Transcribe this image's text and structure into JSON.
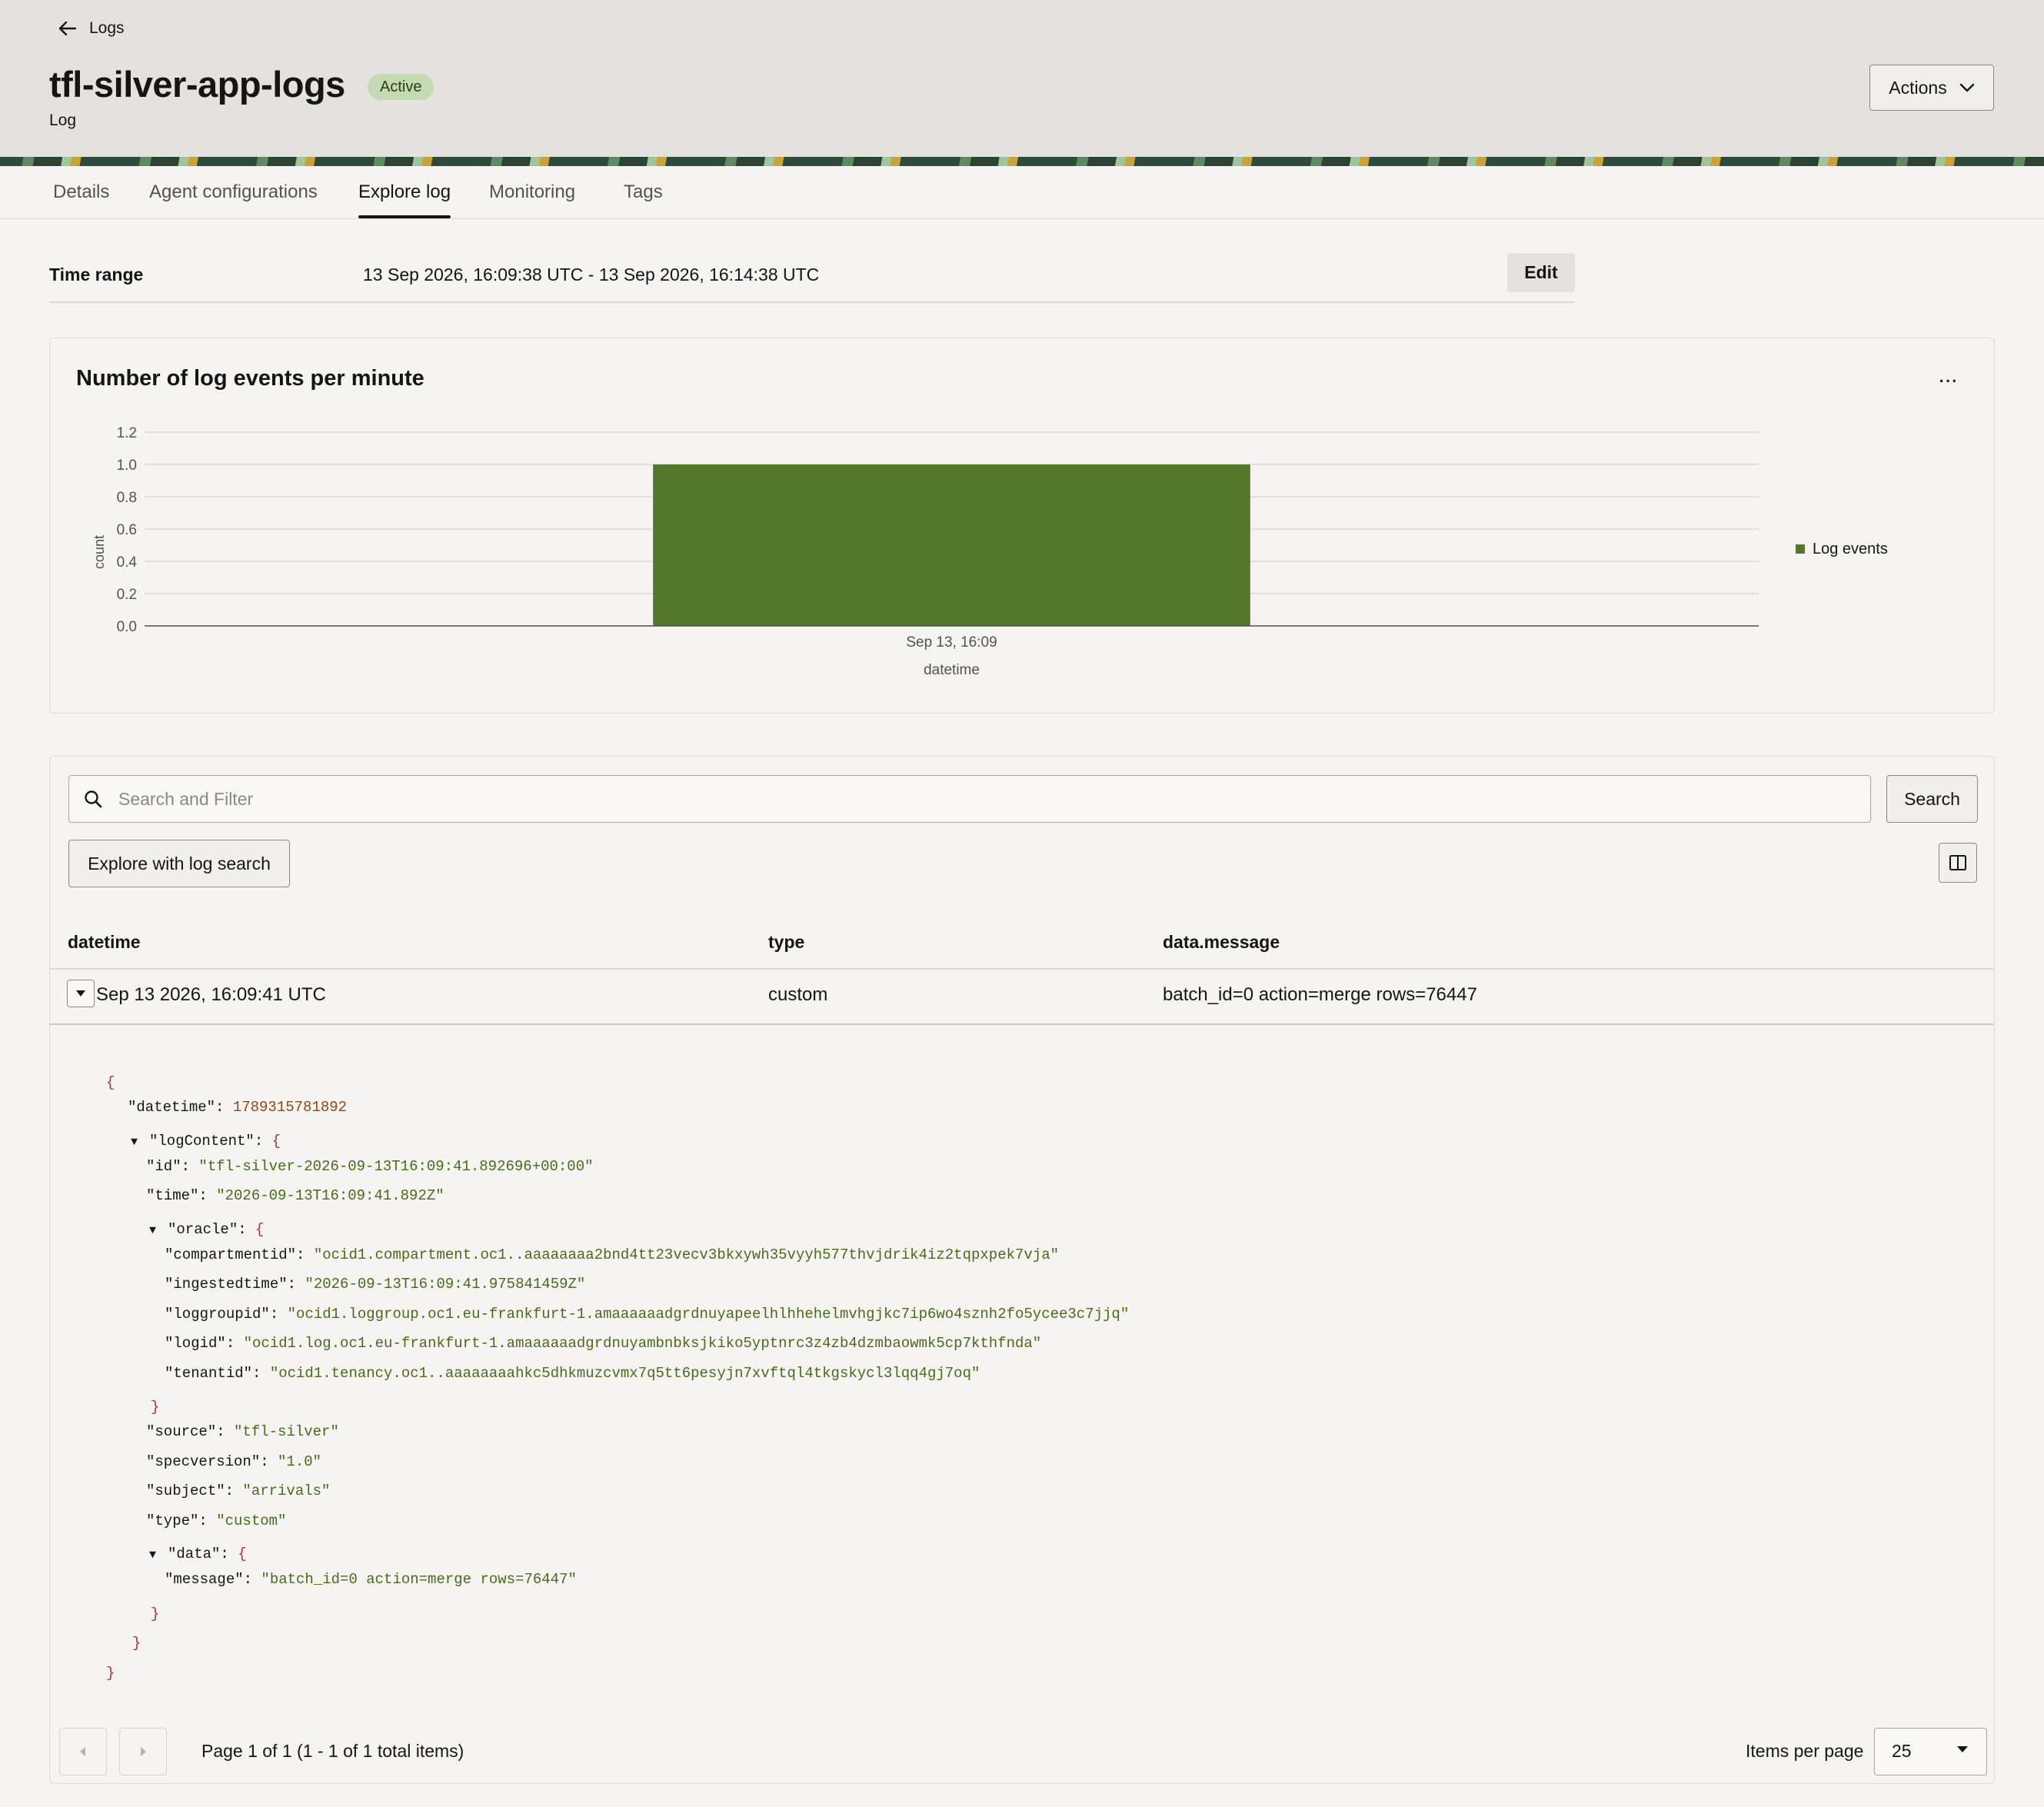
{
  "header": {
    "back_label": "Logs",
    "title": "tfl-silver-app-logs",
    "status": "Active",
    "subtitle": "Log",
    "actions_label": "Actions"
  },
  "tabs": [
    {
      "label": "Details",
      "active": false
    },
    {
      "label": "Agent configurations",
      "active": false
    },
    {
      "label": "Explore log",
      "active": true
    },
    {
      "label": "Monitoring",
      "active": false
    },
    {
      "label": "Tags",
      "active": false
    }
  ],
  "time_range": {
    "label": "Time range",
    "value": "13 Sep 2026, 16:09:38 UTC - 13 Sep 2026, 16:14:38 UTC",
    "edit_label": "Edit"
  },
  "chart": {
    "title": "Number of log events per minute",
    "menu_label": "...",
    "color": "#54772c"
  },
  "chart_data": {
    "type": "bar",
    "title": "Number of log events per minute",
    "xlabel": "datetime",
    "ylabel": "count",
    "categories": [
      "Sep 13, 16:09"
    ],
    "series": [
      {
        "name": "Log events",
        "values": [
          1.0
        ]
      }
    ],
    "ylim": [
      0,
      1.2
    ],
    "yticks": [
      "0.0",
      "0.2",
      "0.4",
      "0.6",
      "0.8",
      "1.0",
      "1.2"
    ],
    "grid": true,
    "legend": "right"
  },
  "search": {
    "placeholder": "Search and Filter",
    "button_label": "Search",
    "explore_label": "Explore with log search"
  },
  "table": {
    "columns": [
      "datetime",
      "type",
      "data.message"
    ],
    "rows": [
      {
        "datetime": "Sep 13 2026, 16:09:41 UTC",
        "type": "custom",
        "message": "batch_id=0 action=merge rows=76447"
      }
    ]
  },
  "json_view": {
    "datetime": "1789315781892",
    "id": "\"tfl-silver-2026-09-13T16:09:41.892696+00:00\"",
    "time": "\"2026-09-13T16:09:41.892Z\"",
    "compartmentid": "\"ocid1.compartment.oc1..aaaaaaaa2bnd4tt23vecv3bkxywh35vyyh577thvjdrik4iz2tqpxpek7vja\"",
    "ingestedtime": "\"2026-09-13T16:09:41.975841459Z\"",
    "loggroupid": "\"ocid1.loggroup.oc1.eu-frankfurt-1.amaaaaaadgrdnuyapeelhlhhehelmvhgjkc7ip6wo4sznh2fo5ycee3c7jjq\"",
    "logid": "\"ocid1.log.oc1.eu-frankfurt-1.amaaaaaadgrdnuyambnbksjkiko5yptnrc3z4zb4dzmbaowmk5cp7kthfnda\"",
    "tenantid": "\"ocid1.tenancy.oc1..aaaaaaaahkc5dhkmuzcvmx7q5tt6pesyjn7xvftql4tkgskycl3lqq4gj7oq\"",
    "source": "\"tfl-silver\"",
    "specversion": "\"1.0\"",
    "subject": "\"arrivals\"",
    "type": "\"custom\"",
    "message": "\"batch_id=0 action=merge rows=76447\""
  },
  "pagination": {
    "info": "Page 1 of 1 (1 - 1 of 1 total items)",
    "items_per_page_label": "Items per page",
    "items_per_page": "25"
  }
}
